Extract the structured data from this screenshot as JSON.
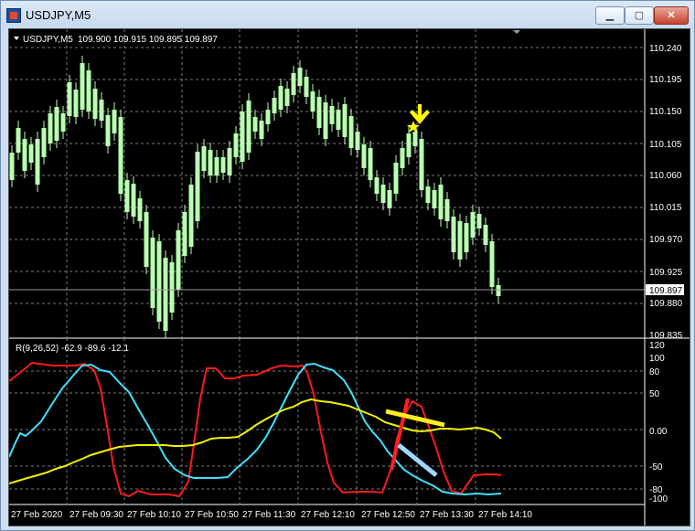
{
  "window": {
    "title": "USDJPY,M5",
    "min_label": "▁",
    "max_label": "▢",
    "close_label": "✕"
  },
  "chart_header": {
    "symbol_tf": "USDJPY,M5",
    "ohlc": "109.900 109.915 109.895 109.897",
    "menu_icon": "triangle-down-icon"
  },
  "price_axis": {
    "labels": [
      "110.240",
      "110.195",
      "110.150",
      "110.105",
      "110.060",
      "110.015",
      "109.970",
      "109.925",
      "109.880",
      "109.835"
    ],
    "current_price": "109.897",
    "current_tag_bg": "#ffffff"
  },
  "indicator": {
    "label": "R(9,26,52) -62.9 -89.6 -12.1",
    "levels": [
      "120",
      "100",
      "80",
      "50",
      "0.00",
      "-50",
      "-80",
      "-100"
    ]
  },
  "time_axis": {
    "labels": [
      "27 Feb 2020",
      "27 Feb 09:30",
      "27 Feb 10:10",
      "27 Feb 10:50",
      "27 Feb 11:30",
      "27 Feb 12:10",
      "27 Feb 12:50",
      "27 Feb 13:30",
      "27 Feb 14:10"
    ]
  },
  "colors": {
    "bg": "#000000",
    "grid": "#888888",
    "candle": "#b8ffb0",
    "signal_arrow": "#ffff00",
    "line_red": "#ff1a1a",
    "line_cyan": "#40e0ff",
    "line_yellow": "#f0f000",
    "drawing_red": "#ff2020",
    "drawing_yellow": "#ffee22",
    "drawing_lightblue": "#9fd7ff"
  }
}
